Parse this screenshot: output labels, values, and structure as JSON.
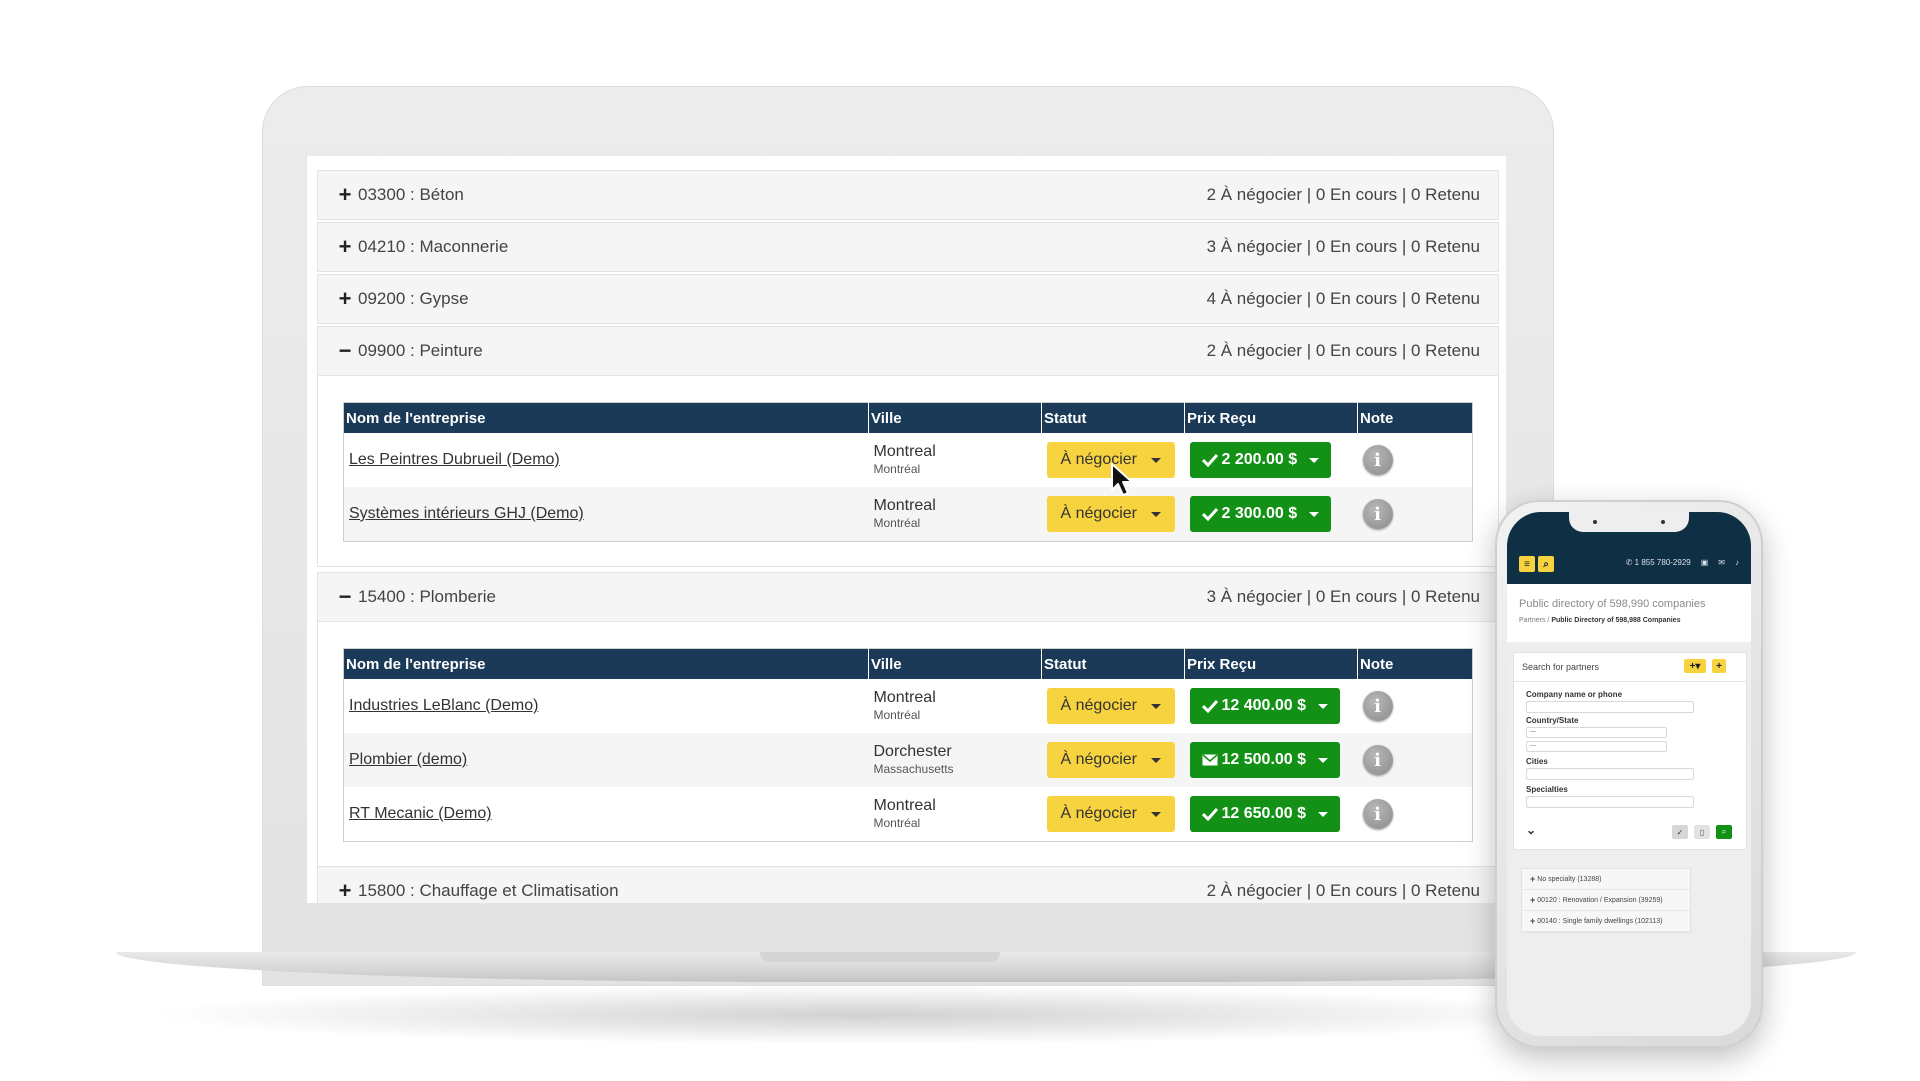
{
  "sections_collapsed_top": [
    {
      "sign": "+",
      "label": "03300 : Béton",
      "summary": "2 À négocier | 0 En cours | 0 Retenu"
    },
    {
      "sign": "+",
      "label": "04210 : Maconnerie",
      "summary": "3 À négocier | 0 En cours | 0 Retenu"
    },
    {
      "sign": "+",
      "label": "09200 : Gypse",
      "summary": "4 À négocier | 0 En cours | 0 Retenu"
    }
  ],
  "section_peinture": {
    "sign": "−",
    "label": "09900 : Peinture",
    "summary": "2 À négocier | 0 En cours | 0 Retenu",
    "columns": [
      "Nom de l'entreprise",
      "Ville",
      "Statut",
      "Prix Reçu",
      "Note"
    ],
    "rows": [
      {
        "company": "Les Peintres Dubrueil (Demo)",
        "city": "Montreal",
        "region": "Montréal",
        "status": "À négocier",
        "price": "2 200.00 $",
        "price_icon": "check-icon"
      },
      {
        "company": "Systèmes intérieurs GHJ (Demo)",
        "city": "Montreal",
        "region": "Montréal",
        "status": "À négocier",
        "price": "2 300.00 $",
        "price_icon": "check-icon"
      }
    ]
  },
  "section_plomberie": {
    "sign": "−",
    "label": "15400 : Plomberie",
    "summary": "3 À négocier | 0 En cours | 0 Retenu",
    "columns": [
      "Nom de l'entreprise",
      "Ville",
      "Statut",
      "Prix Reçu",
      "Note"
    ],
    "rows": [
      {
        "company": "Industries LeBlanc (Demo)",
        "city": "Montreal",
        "region": "Montréal",
        "status": "À négocier",
        "price": "12 400.00 $",
        "price_icon": "check-icon"
      },
      {
        "company": "Plombier (demo)",
        "city": "Dorchester",
        "region": "Massachusetts",
        "status": "À négocier",
        "price": "12 500.00 $",
        "price_icon": "envelope-icon"
      },
      {
        "company": "RT Mecanic (Demo)",
        "city": "Montreal",
        "region": "Montréal",
        "status": "À négocier",
        "price": "12 650.00 $",
        "price_icon": "check-icon"
      }
    ]
  },
  "section_bottom": {
    "sign": "+",
    "label": "15800 : Chauffage et Climatisation",
    "summary": "2 À négocier | 0 En cours | 0 Retenu"
  },
  "info_glyph": "i",
  "phone": {
    "phone_number": "1 855 780-2929",
    "title": "Public directory of 598,990 companies",
    "breadcrumb_parent": "Partners",
    "breadcrumb_sep": " / ",
    "breadcrumb_current": "Public Directory of 598,988 Companies",
    "search_label": "Search for partners",
    "field_company": "Company name or phone",
    "field_country": "Country/State",
    "select_1": "---",
    "select_2": "---",
    "field_cities": "Cities",
    "field_specialties": "Specialties",
    "list": [
      "No specialty (13288)",
      "00120 : Renovation / Expansion (39259)",
      "00140 : Single family dwellings (102113)"
    ]
  },
  "colors": {
    "header_navy": "#1b3a57",
    "status_yellow": "#f7d340",
    "price_green": "#139116",
    "phone_navy": "#0f2f45"
  }
}
